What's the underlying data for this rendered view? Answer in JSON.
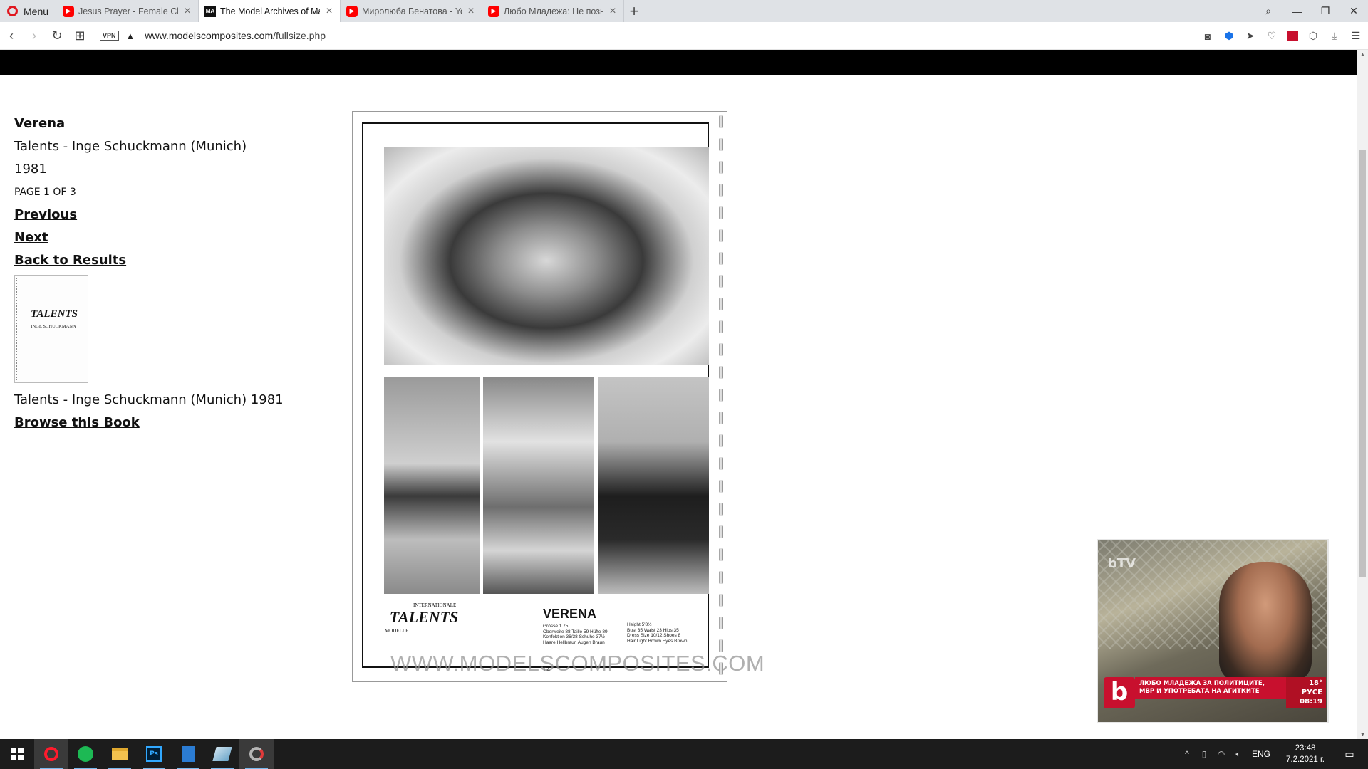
{
  "browser": {
    "menu_label": "Menu",
    "tabs": [
      {
        "title": "Jesus Prayer - Female Choir",
        "favicon": "youtube-icon",
        "active": false
      },
      {
        "title": "The Model Archives of Ma",
        "favicon": "model-archives-icon",
        "favicon_text": "MA",
        "active": true
      },
      {
        "title": "Миролюба Бенатова - YouTube",
        "favicon": "youtube-icon",
        "active": false
      },
      {
        "title": "Любо Младежа: Не позна",
        "favicon": "youtube-icon",
        "active": false
      }
    ],
    "vpn_label": "VPN",
    "url_host": "www.modelscomposites.com",
    "url_path": "/fullsize.php"
  },
  "sidebar": {
    "model_name": "Verena",
    "agency": "Talents - Inge Schuckmann (Munich)",
    "year": "1981",
    "page_indicator": "PAGE 1 OF 3",
    "previous_label": "Previous",
    "next_label": "Next",
    "back_label": "Back to Results",
    "book_caption": "Talents - Inge Schuckmann (Munich) 1981",
    "browse_label": "Browse this Book",
    "thumb_brand": "TALENTS",
    "thumb_sub": "INGE SCHUCKMANN"
  },
  "composite": {
    "brand": "TALENTS",
    "brand_small_1": "INTERNATIONALE",
    "brand_small_2": "MODELLE",
    "name": "VERENA",
    "stats_de": [
      "Grösse 1.75",
      "Oberweite 88 Taille 59 Hüfte 89",
      "Konfektion 36/38 Schuhe 37½",
      "Haare Hellbraun Augen Braun"
    ],
    "stats_en": [
      "Height 5'8½",
      "Bust 35 Waist 23 Hips 35",
      "Dress Size 10/12 Shoes 8",
      "Hair Light Brown Eyes Brown"
    ],
    "watermark": "WWW.MODELSCOMPOSITES.COM",
    "page_number": "64"
  },
  "pip": {
    "channel_logo": "bTV",
    "headline_1": "ЛЮБО МЛАДЕЖА ЗА ПОЛИТИЦИТЕ,",
    "headline_2": "МВР И УПОТРЕБАТА НА АГИТКИТЕ",
    "temp": "18°",
    "city": "РУСЕ",
    "time": "08:19"
  },
  "taskbar": {
    "lang": "ENG",
    "time": "23:48",
    "date": "7.2.2021 г."
  },
  "colors": {
    "tabbar_bg": "#dfe2e6",
    "opera_red": "#e0171f",
    "youtube_red": "#ff0000",
    "btv_red": "#c8102e",
    "taskbar_bg": "#1c1c1c"
  }
}
